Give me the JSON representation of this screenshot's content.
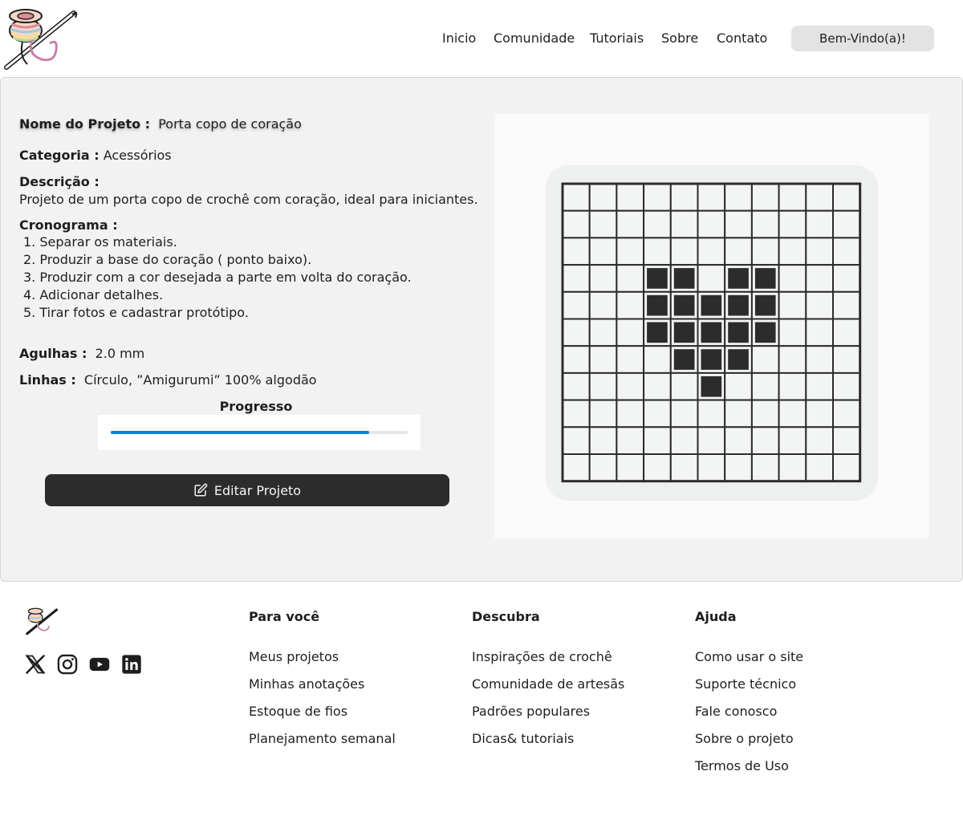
{
  "header": {
    "nav": [
      "Inicio",
      "Comunidade",
      "Tutoriais",
      "Sobre",
      "Contato"
    ],
    "welcome_label": "Bem-Vindo(a)!"
  },
  "project": {
    "name_label": "Nome do Projeto :",
    "name_value": "Porta copo de coração",
    "category_label": "Categoria :",
    "category_value": "Acessórios",
    "description_label": "Descrição :",
    "description_value": "Projeto de um porta copo de crochê com coração, ideal para iniciantes.",
    "schedule_label": "Cronograma :",
    "schedule": [
      "1.  Separar os materiais.",
      "2. Produzir a base do coração ( ponto baixo).",
      "3. Produzir com a cor desejada a parte em volta do coração.",
      "4. Adicionar detalhes.",
      "5. Tirar fotos e cadastrar protótipo."
    ],
    "needles_label": "Agulhas :",
    "needles_value": "2.0 mm",
    "yarn_label": "Linhas :",
    "yarn_value": "Círculo, ”Amigurumi” 100% algodão",
    "progress_label": "Progresso",
    "progress_fraction": 0.87,
    "edit_label": "Editar Projeto"
  },
  "pattern": {
    "rows": [
      "00000000000",
      "00000000000",
      "00000000000",
      "00011011000",
      "00011111000",
      "00011111000",
      "00001110000",
      "00000100000",
      "00000000000",
      "00000000000",
      "00000000000"
    ]
  },
  "footer": {
    "columns": [
      {
        "title": "Para você",
        "links": [
          "Meus projetos",
          "Minhas anotações",
          "Estoque de fios",
          "Planejamento semanal"
        ]
      },
      {
        "title": "Descubra",
        "links": [
          "Inspirações de crochê",
          "Comunidade de artesãs",
          "Padrões populares",
          "Dicas& tutoriais"
        ]
      },
      {
        "title": "Ajuda",
        "links": [
          "Como usar o site",
          "Suporte técnico",
          "Fale conosco",
          "Sobre o projeto",
          "Termos de Uso"
        ]
      }
    ],
    "social": [
      "x-icon",
      "instagram-icon",
      "youtube-icon",
      "linkedin-icon"
    ]
  },
  "colors": {
    "accent": "#0c7ce6",
    "button_dark": "#2c2c2c",
    "filled_cell": "#2c2c2c",
    "panel_bg": "#f2f2f2"
  }
}
